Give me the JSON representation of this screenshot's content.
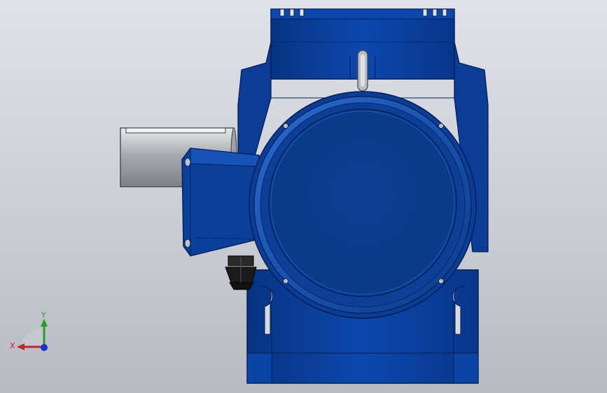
{
  "viewport": {
    "background_top": "#dfe2e8",
    "background_bottom": "#b7bac0"
  },
  "model": {
    "body_color": "#0a3f9a",
    "body_dark": "#062a6d",
    "body_light": "#1a5fc4",
    "shaft_color": "#b8bcc0",
    "gland_color": "#1b1b1b"
  },
  "triad": {
    "x_label": "X",
    "y_label": "Y",
    "x_color": "#c0262a",
    "y_color": "#2a9a2a",
    "z_color": "#1a2fcc"
  }
}
